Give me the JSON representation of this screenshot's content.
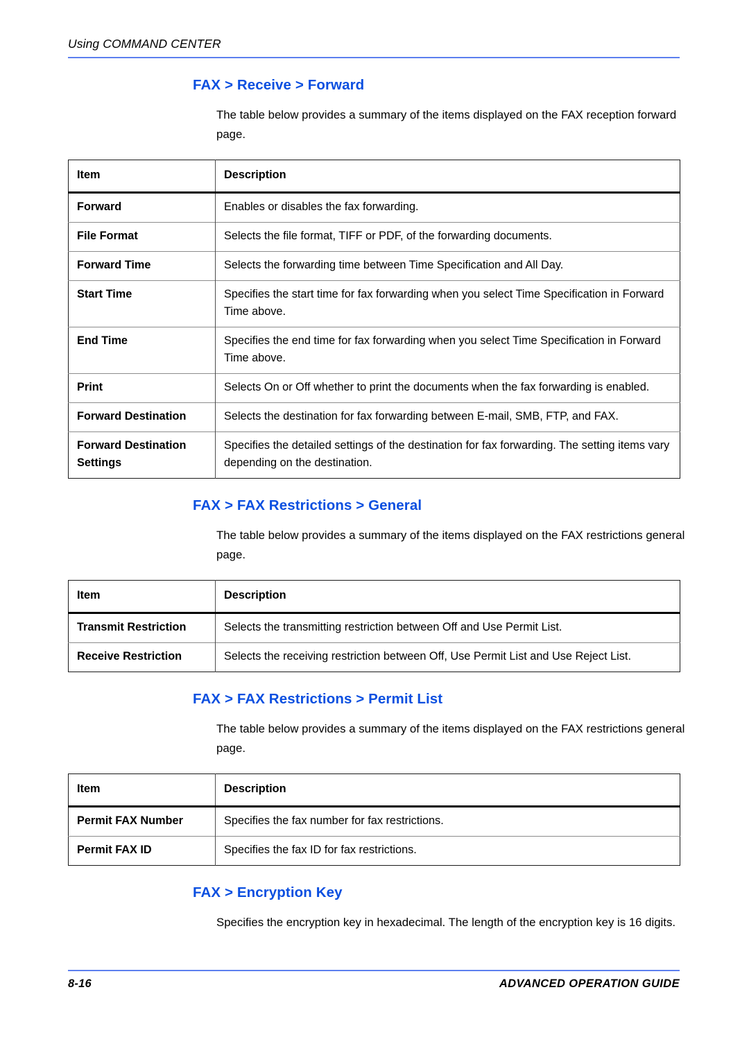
{
  "colors": {
    "heading_blue": "#0b4fe0",
    "rule_blue": "#5c7fef",
    "text_black": "#000000",
    "row_separator_gray": "#8c8c8c"
  },
  "running_header": {
    "text": "Using COMMAND CENTER"
  },
  "footer": {
    "page_number": "8-16",
    "guide_title": "ADVANCED OPERATION GUIDE"
  },
  "sections": [
    {
      "heading": "FAX > Receive > Forward",
      "intro": "The table below provides a summary of the items displayed on the FAX reception forward page.",
      "table": {
        "columns": [
          "Item",
          "Description"
        ],
        "rows": [
          {
            "item": "Forward",
            "description": "Enables or disables the fax forwarding."
          },
          {
            "item": "File Format",
            "description": "Selects the file format, TIFF or PDF, of the forwarding documents."
          },
          {
            "item": "Forward Time",
            "description": "Selects the forwarding time between Time Specification and All Day."
          },
          {
            "item": "Start Time",
            "description": "Specifies the start time for fax forwarding when you select Time Specification in Forward Time above."
          },
          {
            "item": "End Time",
            "description": "Specifies the end time for fax forwarding when you select Time Specification in Forward Time above."
          },
          {
            "item": "Print",
            "description": "Selects On or Off whether to print the documents when the fax forwarding is enabled."
          },
          {
            "item": "Forward Destination",
            "description": "Selects the destination for fax forwarding between E-mail, SMB, FTP, and FAX."
          },
          {
            "item": "Forward Destination Settings",
            "description": "Specifies the detailed settings of the destination for fax forwarding. The setting items vary depending on the destination."
          }
        ]
      }
    },
    {
      "heading": "FAX > FAX Restrictions > General",
      "intro": "The table below provides a summary of the items displayed on the FAX restrictions general page.",
      "table": {
        "columns": [
          "Item",
          "Description"
        ],
        "rows": [
          {
            "item": "Transmit Restriction",
            "description": "Selects the transmitting restriction between Off and Use Permit List."
          },
          {
            "item": "Receive Restriction",
            "description": "Selects the receiving restriction between Off, Use Permit List and Use Reject List."
          }
        ]
      }
    },
    {
      "heading": "FAX > FAX Restrictions > Permit List",
      "intro": "The table below provides a summary of the items displayed on the FAX restrictions general page.",
      "table": {
        "columns": [
          "Item",
          "Description"
        ],
        "rows": [
          {
            "item": "Permit FAX Number",
            "description": "Specifies the fax number for fax restrictions."
          },
          {
            "item": "Permit FAX ID",
            "description": "Specifies the fax ID for fax restrictions."
          }
        ]
      }
    },
    {
      "heading": "FAX > Encryption Key",
      "intro": "Specifies the encryption key in hexadecimal. The length of the encryption key is 16 digits.",
      "table": null
    }
  ]
}
